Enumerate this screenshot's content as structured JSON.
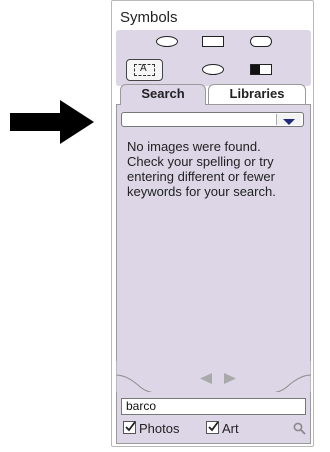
{
  "panel": {
    "title": "Symbols",
    "shapes": [
      "ellipse-icon",
      "rectangle-icon",
      "rounded-rectangle-icon",
      "text-box-icon",
      "lens-icon",
      "half-filled-rectangle-icon"
    ],
    "text_box_glyph": "A",
    "tabs": [
      {
        "label": "Search",
        "selected": true
      },
      {
        "label": "Libraries",
        "selected": false
      }
    ],
    "search": {
      "dropdown_value": "",
      "message": "No images were found. Check your spelling or try entering different or fewer keywords for your search."
    },
    "footer": {
      "query": "barco",
      "options": [
        {
          "label": "Photos",
          "checked": true
        },
        {
          "label": "Art",
          "checked": true
        }
      ]
    }
  },
  "colors": {
    "panel_bg": "#dcd6e7",
    "dropdown_arrow": "#1f2a7a"
  }
}
